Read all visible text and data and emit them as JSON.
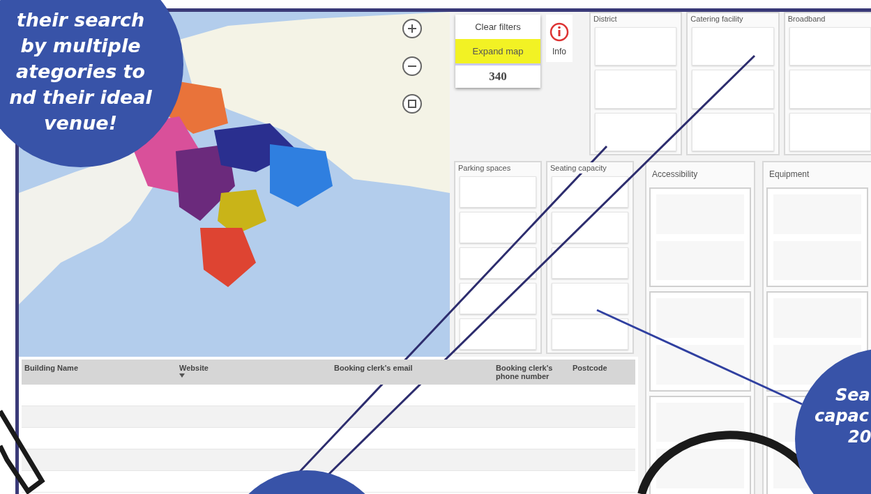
{
  "filter_callout": {
    "lines": [
      "their search",
      "by multiple",
      "ategories to",
      "nd their ideal",
      "venue!"
    ]
  },
  "controls": {
    "clear_button": "Clear filters",
    "expand_button": "Expand map",
    "count": "340",
    "info_label": "Info"
  },
  "slicers_top": [
    {
      "title": "District"
    },
    {
      "title": "Catering facility"
    },
    {
      "title": "Broadband"
    }
  ],
  "slicers_middle": [
    {
      "title": "Parking spaces"
    },
    {
      "title": "Seating capacity"
    }
  ],
  "slicers_grouped": [
    {
      "title": "Accessibility"
    },
    {
      "title": "Equipment"
    }
  ],
  "table": {
    "columns": [
      "Building Name",
      "Website",
      "Booking clerk's email",
      "Booking clerk's phone number",
      "Postcode"
    ]
  },
  "seating_callout": {
    "lines": [
      "Sea",
      "capac",
      "20"
    ]
  }
}
